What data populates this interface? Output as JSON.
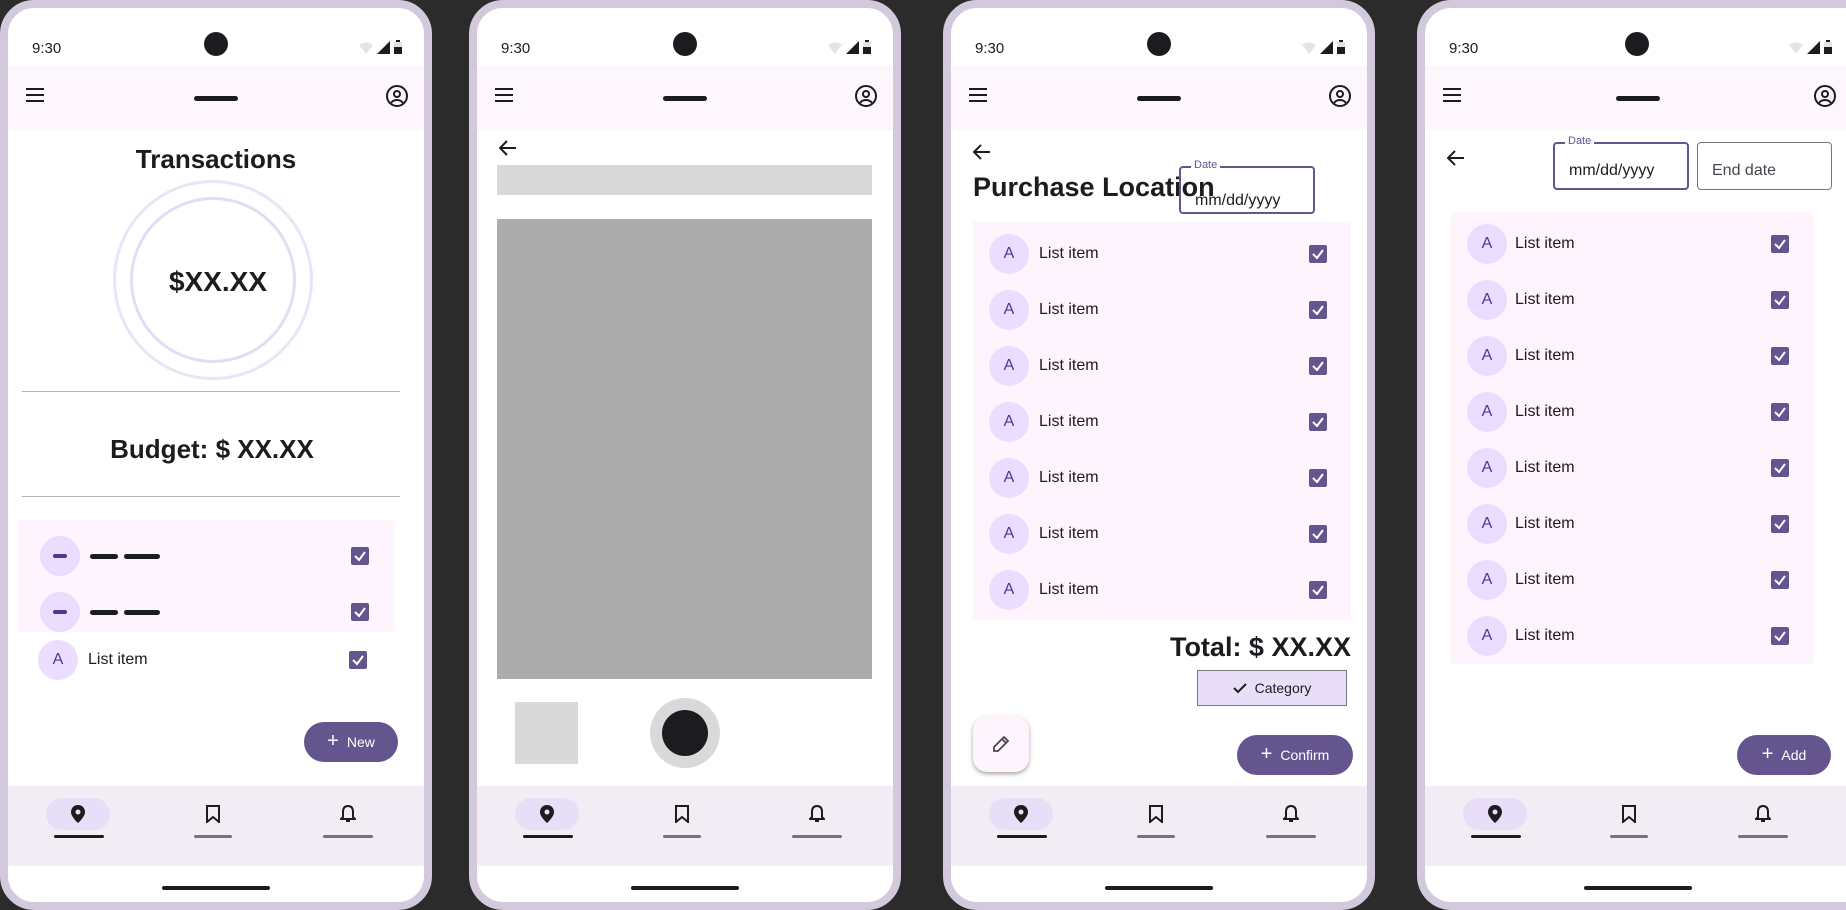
{
  "status": {
    "time": "9:30"
  },
  "screen1": {
    "title": "Transactions",
    "amount": "$XX.XX",
    "budget": "Budget: $ XX.XX",
    "list_item": {
      "avatar": "A",
      "label": "List item"
    },
    "fab_label": "New"
  },
  "screen3": {
    "title": "Purchase Location",
    "date_label": "Date",
    "date_placeholder": "mm/dd/yyyy",
    "items": [
      {
        "avatar": "A",
        "label": "List item"
      },
      {
        "avatar": "A",
        "label": "List item"
      },
      {
        "avatar": "A",
        "label": "List item"
      },
      {
        "avatar": "A",
        "label": "List item"
      },
      {
        "avatar": "A",
        "label": "List item"
      },
      {
        "avatar": "A",
        "label": "List item"
      },
      {
        "avatar": "A",
        "label": "List item"
      }
    ],
    "total": "Total: $ XX.XX",
    "category_label": "Category",
    "confirm_label": "Confirm"
  },
  "screen4": {
    "date_label": "Date",
    "date_placeholder": "mm/dd/yyyy",
    "end_date_placeholder": "End date",
    "items": [
      {
        "avatar": "A",
        "label": "List item"
      },
      {
        "avatar": "A",
        "label": "List item"
      },
      {
        "avatar": "A",
        "label": "List item"
      },
      {
        "avatar": "A",
        "label": "List item"
      },
      {
        "avatar": "A",
        "label": "List item"
      },
      {
        "avatar": "A",
        "label": "List item"
      },
      {
        "avatar": "A",
        "label": "List item"
      },
      {
        "avatar": "A",
        "label": "List item"
      }
    ],
    "add_label": "Add"
  },
  "colors": {
    "primary": "#65558f",
    "primary_container": "#eaddff",
    "surface_container": "#f2ecf5",
    "list_bg": "#fdf4fd",
    "placeholder_gray": "#d9d9d9",
    "image_gray": "#acacac"
  },
  "icons": {
    "menu": "menu-icon",
    "account": "account-circle-icon",
    "back": "arrow-back-icon",
    "nav": [
      "location-pin-icon",
      "bookmark-icon",
      "bell-icon"
    ],
    "edit": "pencil-icon",
    "check": "check-icon"
  }
}
